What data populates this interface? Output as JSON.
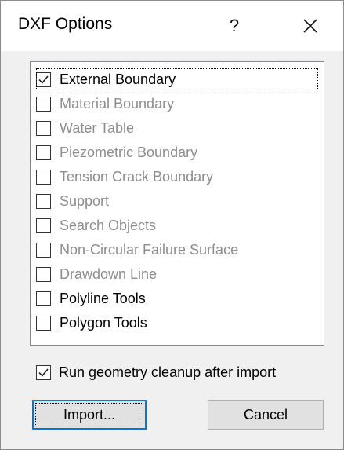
{
  "dialog": {
    "title": "DXF Options",
    "help_label": "?",
    "close_icon": "close-icon"
  },
  "options": [
    {
      "label": "External Boundary",
      "checked": true,
      "enabled": true
    },
    {
      "label": "Material Boundary",
      "checked": false,
      "enabled": false
    },
    {
      "label": "Water Table",
      "checked": false,
      "enabled": false
    },
    {
      "label": "Piezometric Boundary",
      "checked": false,
      "enabled": false
    },
    {
      "label": "Tension Crack Boundary",
      "checked": false,
      "enabled": false
    },
    {
      "label": "Support",
      "checked": false,
      "enabled": false
    },
    {
      "label": "Search Objects",
      "checked": false,
      "enabled": false
    },
    {
      "label": "Non-Circular Failure Surface",
      "checked": false,
      "enabled": false
    },
    {
      "label": "Drawdown Line",
      "checked": false,
      "enabled": false
    },
    {
      "label": "Polyline Tools",
      "checked": false,
      "enabled": true
    },
    {
      "label": "Polygon Tools",
      "checked": false,
      "enabled": true
    }
  ],
  "cleanup": {
    "label": "Run geometry cleanup after import",
    "checked": true
  },
  "buttons": {
    "import_label": "Import...",
    "cancel_label": "Cancel"
  },
  "colors": {
    "enabled_text": "#000000",
    "disabled_text": "#8d8d8d",
    "accent": "#0078d7"
  }
}
